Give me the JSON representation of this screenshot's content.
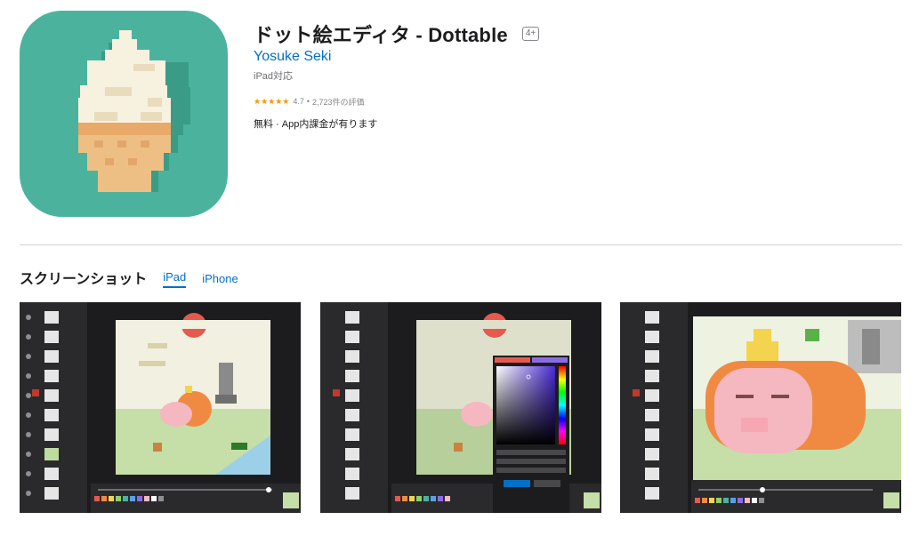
{
  "app": {
    "title": "ドット絵エディタ - Dottable",
    "age_rating": "4+",
    "developer": "Yosuke Seki",
    "compatibility": "iPad対応",
    "rating_stars": "★★★★★",
    "rating_value": "4.7",
    "rating_count": "2,723件の評価",
    "price": "無料 · App内課金が有ります"
  },
  "screenshots": {
    "heading": "スクリーンショット",
    "tabs": [
      {
        "label": "iPad",
        "active": true
      },
      {
        "label": "iPhone",
        "active": false
      }
    ]
  },
  "colors": {
    "accent": "#0070c9",
    "icon_bg": "#4bb39d",
    "star": "#ff9500"
  }
}
